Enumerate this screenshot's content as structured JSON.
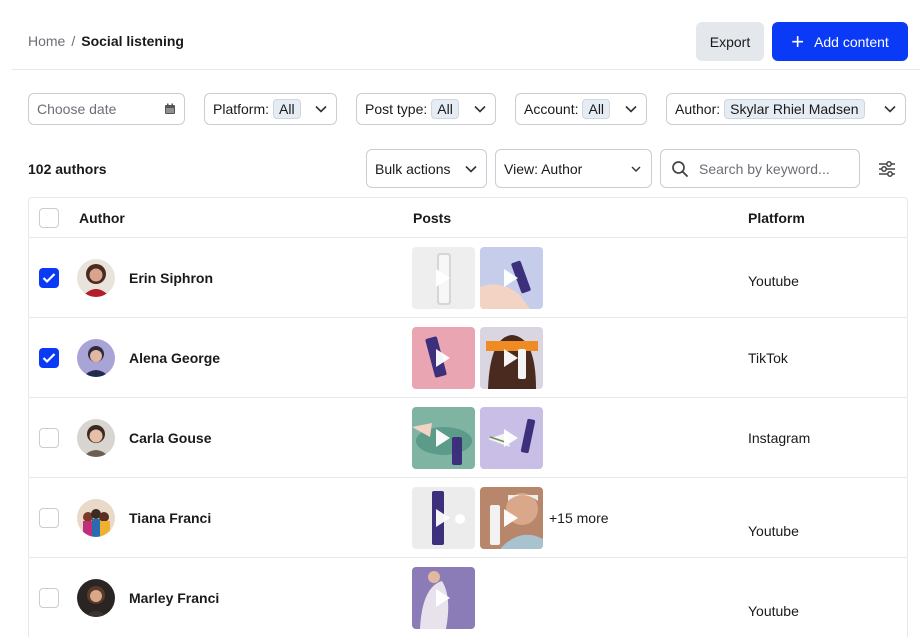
{
  "breadcrumb": {
    "home": "Home",
    "separator": "/",
    "current": "Social listening"
  },
  "header": {
    "export_label": "Export",
    "add_label": "Add content"
  },
  "filters": {
    "date_placeholder": "Choose date",
    "platform": {
      "label": "Platform:",
      "value": "All"
    },
    "post_type": {
      "label": "Post type:",
      "value": "All"
    },
    "account": {
      "label": "Account:",
      "value": "All"
    },
    "author": {
      "label": "Author:",
      "value": "Skylar Rhiel Madsen"
    }
  },
  "toolbar": {
    "count": "102 authors",
    "bulk_actions": "Bulk actions",
    "view": "View: Author",
    "search_placeholder": "Search by keyword..."
  },
  "table": {
    "columns": [
      "Author",
      "Posts",
      "Platform"
    ],
    "rows": [
      {
        "name": "Erin Siphron",
        "platform": "Youtube",
        "checked": true,
        "more": ""
      },
      {
        "name": "Alena George",
        "platform": "TikTok",
        "checked": true,
        "more": ""
      },
      {
        "name": "Carla Gouse",
        "platform": "Instagram",
        "checked": false,
        "more": ""
      },
      {
        "name": "Tiana Franci",
        "platform": "Youtube",
        "checked": false,
        "more": "+15 more"
      },
      {
        "name": "Marley Franci",
        "platform": "Youtube",
        "checked": false,
        "more": ""
      }
    ]
  },
  "colors": {
    "primary": "#0a3af5",
    "secondary_bg": "#e4e7ec",
    "border": "#c9cdd4"
  }
}
